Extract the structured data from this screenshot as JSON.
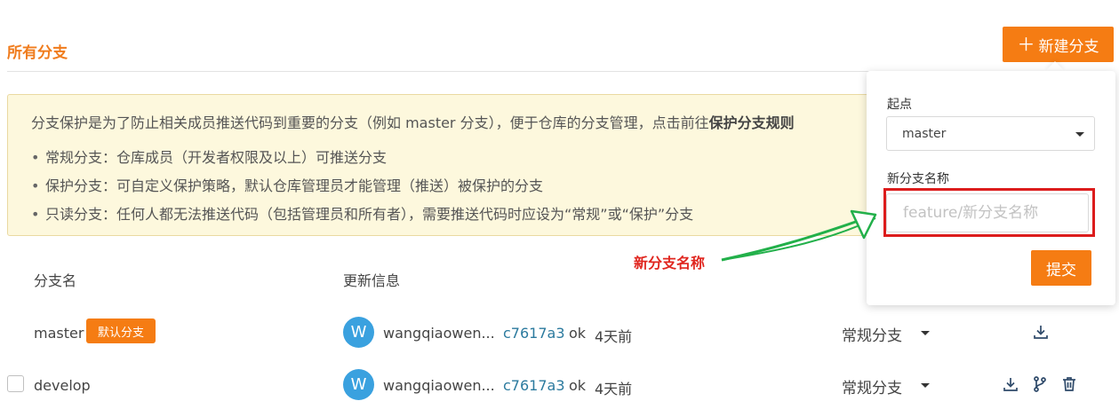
{
  "header": {
    "title": "所有分支",
    "new_branch_label": "新建分支",
    "new_branch_icon": "plus-icon"
  },
  "notice": {
    "intro_prefix": "分支保护是为了防止相关成员推送代码到重要的分支（例如 master 分支），便于仓库的分支管理，点击前往",
    "intro_link": "保护分支规则",
    "items": [
      "常规分支：仓库成员（开发者权限及以上）可推送分支",
      "保护分支：可自定义保护策略，默认仓库管理员才能管理（推送）被保护的分支",
      "只读分支：任何人都无法推送代码（包括管理员和所有者），需要推送代码时应设为“常规”或“保护”分支"
    ]
  },
  "table": {
    "headers": {
      "branch_name": "分支名",
      "update_info": "更新信息"
    },
    "rows": [
      {
        "name": "master",
        "badge": "默认分支",
        "avatar_letter": "W",
        "author": "wangqiaowen...",
        "commit": "c7617a3",
        "message": "ok",
        "time": "4天前",
        "type": "常规分支",
        "actions": [
          "download-icon"
        ]
      },
      {
        "name": "develop",
        "avatar_letter": "W",
        "author": "wangqiaowen...",
        "commit": "c7617a3",
        "message": "ok",
        "time": "4天前",
        "type": "常规分支",
        "actions": [
          "download-icon",
          "branch-icon",
          "trash-icon"
        ]
      }
    ]
  },
  "popover": {
    "start_label": "起点",
    "start_value": "master",
    "name_label": "新分支名称",
    "name_placeholder": "feature/新分支名称",
    "name_value": "",
    "submit_label": "提交"
  },
  "annotation": {
    "text": "新分支名称"
  },
  "colors": {
    "accent": "#f57c13",
    "title": "#f07c1d",
    "notice_bg": "#fdf8dd",
    "avatar": "#3aa1df",
    "commit_link": "#2b7a9e",
    "annotation": "#e0261f",
    "annotation_arrow": "#22b04a"
  }
}
